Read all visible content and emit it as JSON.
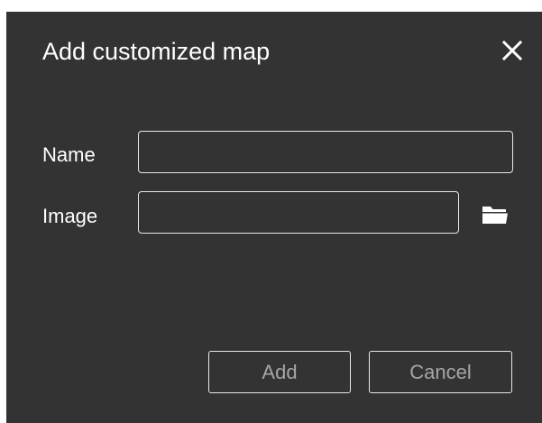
{
  "dialog": {
    "title": "Add customized map",
    "close_icon": "close-icon"
  },
  "form": {
    "name_label": "Name",
    "name_value": "",
    "image_label": "Image",
    "image_value": "",
    "browse_icon": "folder-icon"
  },
  "buttons": {
    "add_label": "Add",
    "cancel_label": "Cancel"
  },
  "colors": {
    "background": "#333333",
    "text": "#ffffff",
    "disabled_text": "#a6a6a6",
    "border": "#e8e8e8"
  }
}
